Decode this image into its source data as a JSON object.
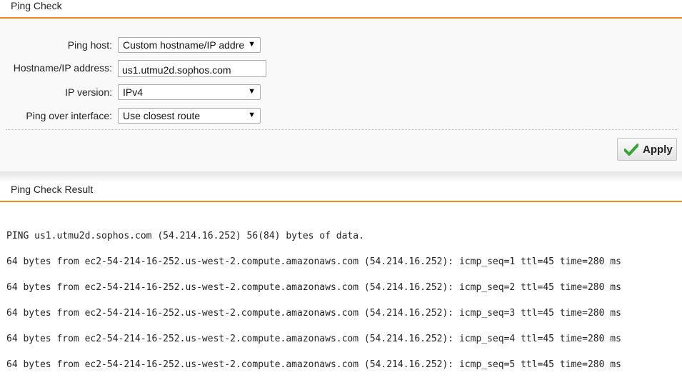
{
  "ping_check": {
    "title": "Ping Check",
    "fields": {
      "ping_host": {
        "label": "Ping host:",
        "value": "Custom hostname/IP address"
      },
      "hostname": {
        "label": "Hostname/IP address:",
        "value": "us1.utmu2d.sophos.com"
      },
      "ip_version": {
        "label": "IP version:",
        "value": "IPv4"
      },
      "interface": {
        "label": "Ping over interface:",
        "value": "Use closest route"
      }
    },
    "apply_label": "Apply",
    "colors": {
      "accent": "#ef8a1e",
      "check": "#3aa335"
    }
  },
  "result": {
    "title": "Ping Check Result",
    "lines": [
      "PING us1.utmu2d.sophos.com (54.214.16.252) 56(84) bytes of data.",
      "64 bytes from ec2-54-214-16-252.us-west-2.compute.amazonaws.com (54.214.16.252): icmp_seq=1 ttl=45 time=280 ms",
      "64 bytes from ec2-54-214-16-252.us-west-2.compute.amazonaws.com (54.214.16.252): icmp_seq=2 ttl=45 time=280 ms",
      "64 bytes from ec2-54-214-16-252.us-west-2.compute.amazonaws.com (54.214.16.252): icmp_seq=3 ttl=45 time=280 ms",
      "64 bytes from ec2-54-214-16-252.us-west-2.compute.amazonaws.com (54.214.16.252): icmp_seq=4 ttl=45 time=280 ms",
      "64 bytes from ec2-54-214-16-252.us-west-2.compute.amazonaws.com (54.214.16.252): icmp_seq=5 ttl=45 time=280 ms"
    ]
  }
}
